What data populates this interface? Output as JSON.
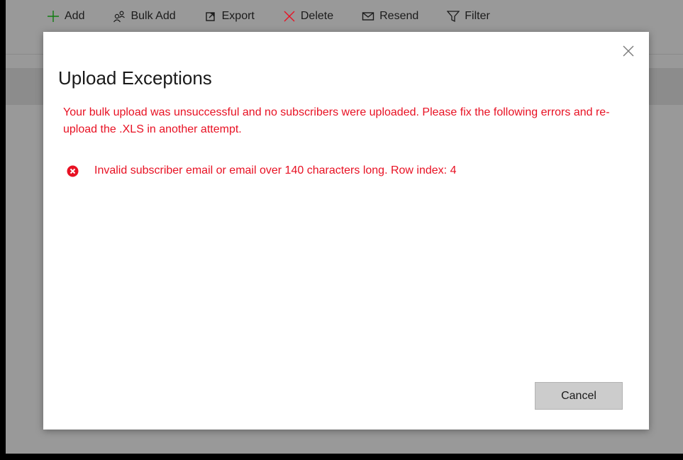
{
  "toolbar": {
    "items": [
      {
        "label": "Add",
        "icon": "plus-icon"
      },
      {
        "label": "Bulk Add",
        "icon": "people-icon"
      },
      {
        "label": "Export",
        "icon": "export-icon"
      },
      {
        "label": "Delete",
        "icon": "x-icon"
      },
      {
        "label": "Resend",
        "icon": "mail-icon"
      },
      {
        "label": "Filter",
        "icon": "filter-icon"
      }
    ]
  },
  "dialog": {
    "title": "Upload Exceptions",
    "message": "Your bulk upload was unsuccessful and no subscribers were uploaded.  Please fix the following errors and re-upload the .XLS in another attempt.",
    "errors": [
      {
        "text": "Invalid subscriber email or email over 140 characters long. Row index: 4",
        "icon": "error-circle-icon"
      }
    ],
    "cancel_label": "Cancel",
    "close_icon": "close-icon"
  },
  "colors": {
    "error": "#e81123",
    "add_icon": "#107c10",
    "delete_icon": "#e81123",
    "overlay": "#999999",
    "dialog_bg": "#ffffff",
    "button_bg": "#cccccc"
  }
}
